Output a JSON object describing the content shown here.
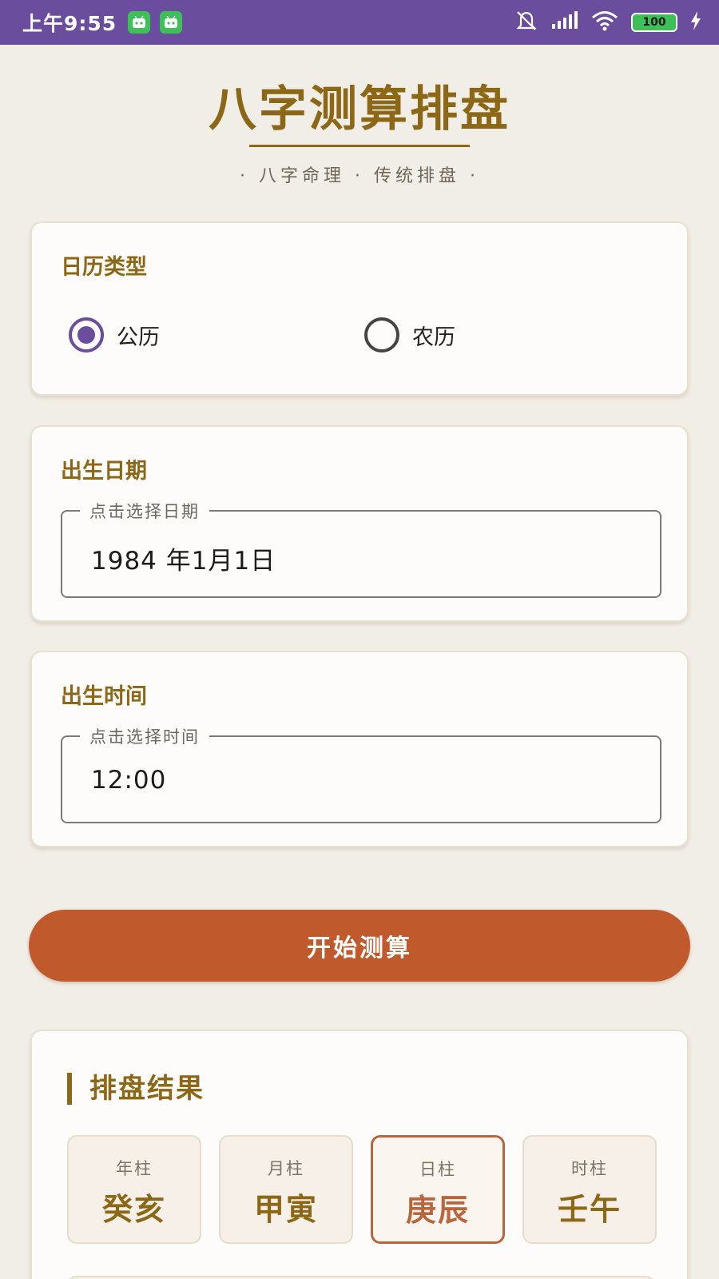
{
  "status_bar": {
    "time": "上午9:55",
    "battery": "100"
  },
  "header": {
    "title": "八字测算排盘",
    "subtitle": "· 八字命理 · 传统排盘 ·"
  },
  "calendar_card": {
    "label": "日历类型",
    "options": [
      {
        "label": "公历",
        "selected": true
      },
      {
        "label": "农历",
        "selected": false
      }
    ]
  },
  "date_card": {
    "label": "出生日期",
    "field_hint": "点击选择日期",
    "value": "1984 年1月1日"
  },
  "time_card": {
    "label": "出生时间",
    "field_hint": "点击选择时间",
    "value": "12:00"
  },
  "start_button": "开始测算",
  "result": {
    "title": "排盘结果",
    "pillars": [
      {
        "label": "年柱",
        "value": "癸亥",
        "active": false
      },
      {
        "label": "月柱",
        "value": "甲寅",
        "active": false
      },
      {
        "label": "日柱",
        "value": "庚辰",
        "active": true
      },
      {
        "label": "时柱",
        "value": "壬午",
        "active": false
      }
    ]
  },
  "colors": {
    "status_bar": "#6a4d9c",
    "accent_gold": "#8b6716",
    "button": "#c05a2c",
    "background": "#f1eee7"
  }
}
